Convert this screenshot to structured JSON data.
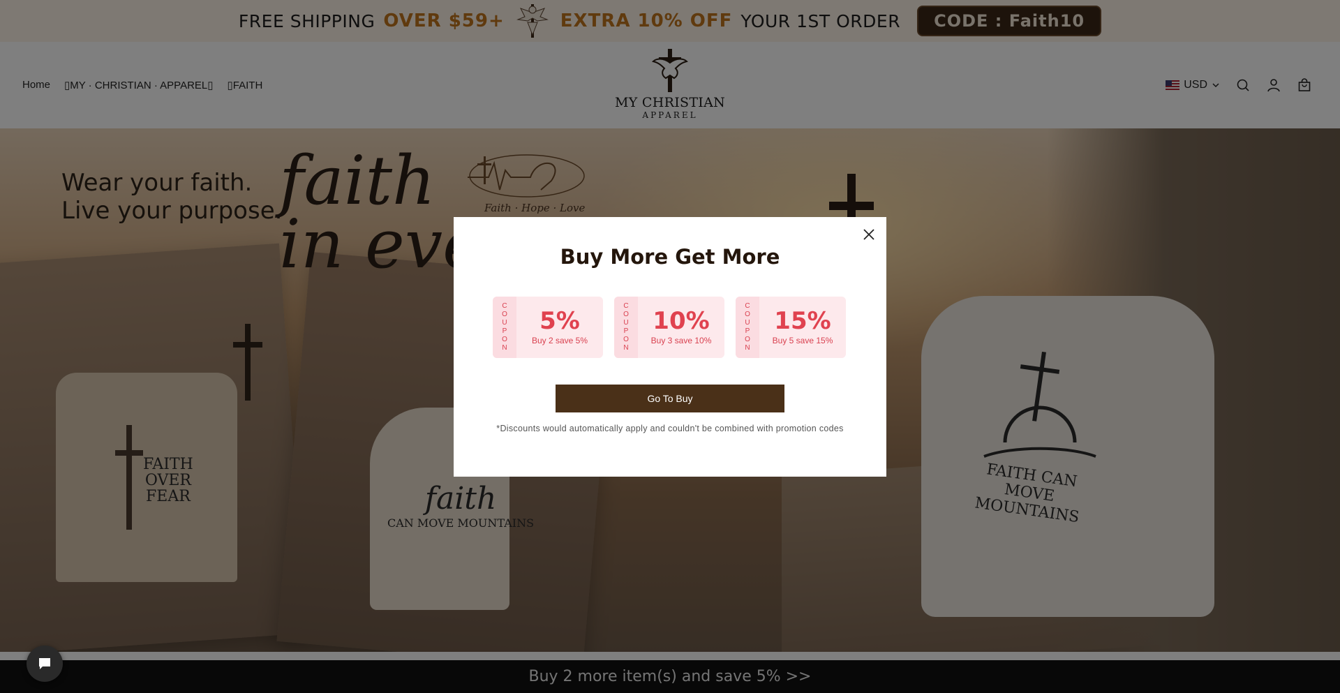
{
  "announcement": {
    "part1": "FREE SHIPPING",
    "part2": "OVER $59+",
    "part3": "EXTRA 10% OFF",
    "part4": "YOUR 1ST ORDER",
    "code": "CODE :  Faith10"
  },
  "header": {
    "nav": [
      {
        "label": "Home"
      },
      {
        "label": "▯MY · CHRISTIAN · APPAREL▯"
      },
      {
        "label": "▯FAITH"
      }
    ],
    "logo_name": "MY CHRISTIAN",
    "logo_sub": "APPAREL",
    "currency": "USD",
    "icons": [
      "search-icon",
      "account-icon",
      "cart-icon"
    ]
  },
  "hero": {
    "tagline_line1": "Wear your faith.",
    "tagline_line2": "Live your purpose.",
    "big_line1": "faith",
    "big_line2": "in ever",
    "ecg_caption": "Faith · Hope · Love",
    "shirt1_print": [
      "FAITH",
      "OVER",
      "FEAR"
    ],
    "shirt2_print_big": "faith",
    "shirt2_print_small": "CAN MOVE MOUNTAINS",
    "shirt3_print": "FAITH CAN MOVE MOUNTAINS"
  },
  "modal": {
    "title": "Buy More Get More",
    "coupon_side": [
      "C",
      "O",
      "U",
      "P",
      "O",
      "N"
    ],
    "coupons": [
      {
        "percent": "5%",
        "desc": "Buy 2 save 5%"
      },
      {
        "percent": "10%",
        "desc": "Buy 3 save 10%"
      },
      {
        "percent": "15%",
        "desc": "Buy 5 save 15%"
      }
    ],
    "button": "Go To Buy",
    "disclaimer": "*Discounts would automatically apply and couldn't be combined with promotion codes"
  },
  "save_bar": "Buy 2 more item(s) and save 5%  >>",
  "colors": {
    "accent": "#4a3018",
    "coupon_red": "#e0424f",
    "announce_orange": "#c0741c"
  }
}
